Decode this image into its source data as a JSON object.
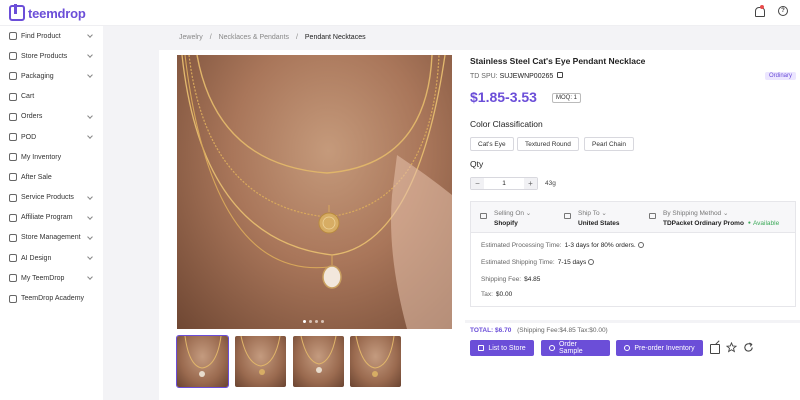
{
  "header": {
    "logo_text": "teemdrop",
    "icons": [
      "bell-icon",
      "help-icon"
    ]
  },
  "sidebar": {
    "items": [
      {
        "label": "Find Product",
        "icon": "search-icon",
        "has_chevron": true
      },
      {
        "label": "Store Products",
        "icon": "shield-icon",
        "has_chevron": true
      },
      {
        "label": "Packaging",
        "icon": "tag-icon",
        "has_chevron": true
      },
      {
        "label": "Cart",
        "icon": "cart-icon",
        "has_chevron": false
      },
      {
        "label": "Orders",
        "icon": "orders-icon",
        "has_chevron": true
      },
      {
        "label": "POD",
        "icon": "pod-icon",
        "has_chevron": true
      },
      {
        "label": "My Inventory",
        "icon": "inventory-icon",
        "has_chevron": false
      },
      {
        "label": "After Sale",
        "icon": "after-sale-icon",
        "has_chevron": false
      },
      {
        "label": "Service Products",
        "icon": "service-icon",
        "has_chevron": true
      },
      {
        "label": "Affiliate Program",
        "icon": "affiliate-icon",
        "has_chevron": true
      },
      {
        "label": "Store Management",
        "icon": "store-icon",
        "has_chevron": true
      },
      {
        "label": "AI Design",
        "icon": "pen-icon",
        "has_chevron": true
      },
      {
        "label": "My TeemDrop",
        "icon": "user-icon",
        "has_chevron": true
      },
      {
        "label": "TeemDrop Academy",
        "icon": "academy-icon",
        "has_chevron": false
      }
    ]
  },
  "breadcrumb": {
    "items": [
      "Jewelry",
      "Necklaces & Pendants",
      "Pendant Necktaces"
    ],
    "separator": "/"
  },
  "product": {
    "title": "Stainless Steel Cat's Eye Pendant Necklace",
    "spu_label": "TD SPU:",
    "spu_value": "SUJEWNP00265",
    "badge": "Ordinary",
    "price": "$1.85-3.53",
    "moq": "MOQ: 1",
    "color_label": "Color Classification",
    "color_options": [
      "Cat's Eye",
      "Textured Round",
      "Pearl Chain"
    ],
    "qty_label": "Qty",
    "qty_minus": "−",
    "qty_value": "1",
    "qty_plus": "+",
    "weight": "43g",
    "image_count": 4,
    "active_image": 1
  },
  "shipping": {
    "selling_on_label": "Selling On",
    "selling_on_value": "Shopify",
    "ship_to_label": "Ship To",
    "ship_to_value": "United States",
    "method_label": "By Shipping Method",
    "method_value": "TDPacket Ordinary Promo",
    "availability": "Available",
    "processing_label": "Estimated Processing Time:",
    "processing_value": "1-3 days for 80% orders.",
    "shipping_time_label": "Estimated Shipping Time:",
    "shipping_time_value": "7-15 days",
    "fee_label": "Shipping Fee:",
    "fee_value": "$4.85",
    "tax_label": "Tax:",
    "tax_value": "$0.00"
  },
  "total": {
    "label": "TOTAL:",
    "amount": "$6.70",
    "detail": "(Shipping Fee:$4.85  Tax:$0.00)"
  },
  "actions": {
    "list_to_store": "List to Store",
    "order_sample": "Order Sample",
    "preorder": "Pre-order Inventory"
  },
  "colors": {
    "accent": "#6b4ed8",
    "available": "#3daa5a"
  }
}
